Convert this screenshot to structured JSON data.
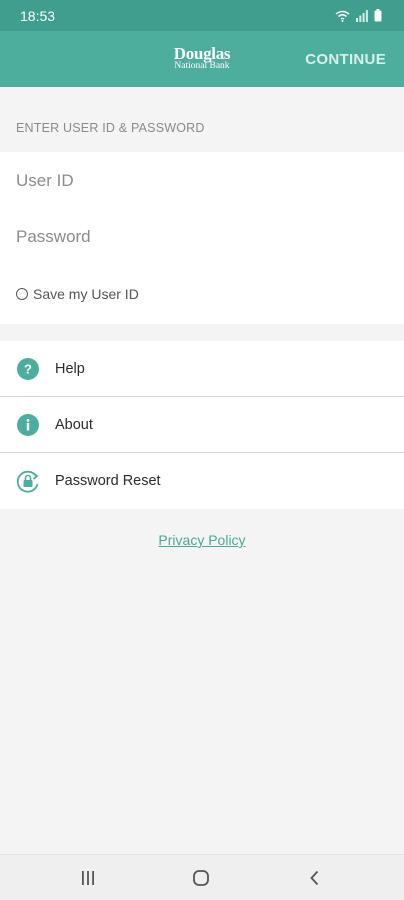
{
  "status_bar": {
    "time": "18:53",
    "icons": [
      "wifi-icon",
      "signal-icon",
      "battery-icon"
    ]
  },
  "app_bar": {
    "logo_line1": "Douglas",
    "logo_line2": "National Bank",
    "continue_label": "CONTINUE"
  },
  "login": {
    "section_header": "ENTER USER ID & PASSWORD",
    "user_id": {
      "placeholder": "User ID",
      "value": ""
    },
    "password": {
      "placeholder": "Password",
      "value": ""
    },
    "save_user_id_label": "Save my User ID",
    "save_user_id_checked": false
  },
  "menu": {
    "items": [
      {
        "label": "Help",
        "icon": "help-icon"
      },
      {
        "label": "About",
        "icon": "info-icon"
      },
      {
        "label": "Password Reset",
        "icon": "password-reset-icon"
      }
    ]
  },
  "footer": {
    "privacy_policy_label": "Privacy Policy"
  },
  "navigation_bar": {
    "buttons": [
      "recent-apps-icon",
      "home-icon",
      "back-icon"
    ]
  },
  "colors": {
    "brand": "#4dae9e",
    "status_bar": "#3f9e8e",
    "link": "#4aa897",
    "background": "#f4f4f4"
  }
}
